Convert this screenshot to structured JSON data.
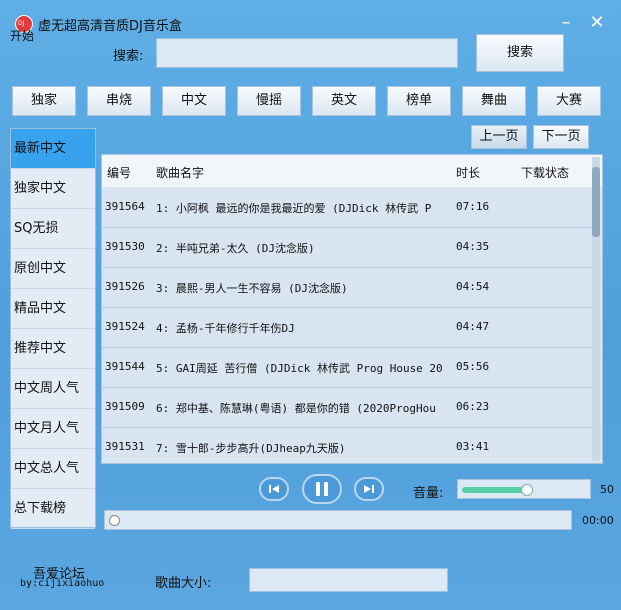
{
  "window": {
    "title": "虚无超高清音质DJ音乐盒",
    "start_label": "开始",
    "minimize": "–",
    "close": "✕"
  },
  "search": {
    "label": "搜索:",
    "value": "",
    "button": "搜索"
  },
  "categories": [
    "独家",
    "串烧",
    "中文",
    "慢摇",
    "英文",
    "榜单",
    "舞曲",
    "大赛"
  ],
  "sidebar": [
    "最新中文",
    "独家中文",
    "SQ无损",
    "原创中文",
    "精品中文",
    "推荐中文",
    "中文周人气",
    "中文月人气",
    "中文总人气",
    "总下载榜"
  ],
  "sidebar_active": 0,
  "paging": {
    "prev": "上一页",
    "next": "下一页"
  },
  "table": {
    "headers": [
      "编号",
      "歌曲名字",
      "时长",
      "下载状态"
    ],
    "rows": [
      {
        "id": "391564",
        "name": "1: 小阿枫  最远的你是我最近的爱 (DJDick 林传武 P",
        "dur": "07:16",
        "status": ""
      },
      {
        "id": "391530",
        "name": "2: 半吨兄弟-太久 (DJ沈念版)",
        "dur": "04:35",
        "status": ""
      },
      {
        "id": "391526",
        "name": "3: 晨熙-男人一生不容易 (DJ沈念版)",
        "dur": "04:54",
        "status": ""
      },
      {
        "id": "391524",
        "name": "4: 孟杨-千年修行千年伤DJ",
        "dur": "04:47",
        "status": ""
      },
      {
        "id": "391544",
        "name": "5: GAI周延 苦行僧  (DJDick 林传武 Prog House 20",
        "dur": "05:56",
        "status": ""
      },
      {
        "id": "391509",
        "name": "6: 郑中基、陈慧琳(粤语)  都是你的错 (2020ProgHou",
        "dur": "06:23",
        "status": ""
      },
      {
        "id": "391531",
        "name": "7: 雪十郎-步步高升(DJheap九天版)",
        "dur": "03:41",
        "status": ""
      }
    ]
  },
  "player": {
    "volume_label": "音量:",
    "volume_value": "50",
    "volume_fraction": 0.5,
    "time": "00:00",
    "progress_fraction": 0
  },
  "footer": {
    "forum": "吾爱论坛",
    "by": "by:cijixiaohuo",
    "size_label": "歌曲大小:",
    "size_value": ""
  },
  "icons": {
    "logo": "music-logo-icon",
    "prev": "skip-previous-icon",
    "pause": "pause-icon",
    "next": "skip-next-icon"
  }
}
